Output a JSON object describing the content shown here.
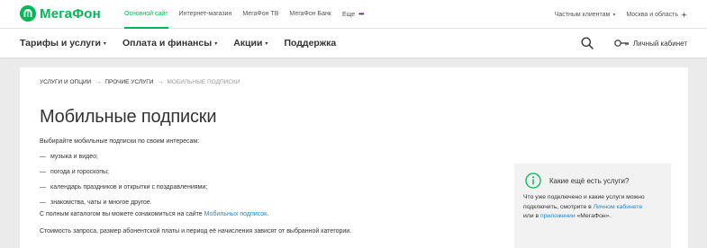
{
  "brand": {
    "name": "МегаФон",
    "color": "#00b956",
    "accent_purple": "#731982",
    "link_color": "#1e88c8"
  },
  "topbar": {
    "items": [
      {
        "label": "Основной сайт",
        "active": true
      },
      {
        "label": "Интернет-магазин",
        "active": false
      },
      {
        "label": "МегаФон ТВ",
        "active": false
      },
      {
        "label": "МегаФон Банк",
        "active": false
      }
    ],
    "more_label": "Еще",
    "more_dots": "•••",
    "clients_label": "Частным клиентам",
    "region_label": "Москва и область"
  },
  "mainnav": {
    "items": [
      {
        "label": "Тарифы и услуги",
        "dropdown": true
      },
      {
        "label": "Оплата и финансы",
        "dropdown": true
      },
      {
        "label": "Акции",
        "dropdown": true
      },
      {
        "label": "Поддержка",
        "dropdown": false
      }
    ],
    "search_icon": "search-icon",
    "account_icon": "key-icon",
    "account_label": "Личный кабинет"
  },
  "breadcrumbs": {
    "items": [
      "Услуги и опции",
      "Прочие услуги"
    ],
    "separator": "→",
    "current": "Мобильные подписки"
  },
  "page": {
    "title": "Мобильные подписки",
    "intro": "Выбирайте мобильные подписки по своим интересам:",
    "bullet_dash": "—",
    "bullets": [
      "музыка и видео;",
      "погода и гороскопы;",
      "календарь праздников и открытки с поздравлениями;",
      "знакомства, чаты и многое другое."
    ],
    "catalog_text": "С полным каталогом вы можете ознакомиться на сайте ",
    "catalog_link": "Мобильных подписок",
    "catalog_end": ".",
    "cost_text": "Стоимость запроса, размер абонентской платы и период её начисления зависят от выбранной категории."
  },
  "aside": {
    "icon": "info-icon",
    "title": "Какие ещё есть услуги?",
    "line1": "Что уже подключено и какие услуги можно",
    "line2_text": "подключить, смотрите в ",
    "line2_link": "Личном кабинете",
    "line3_text": "или в ",
    "line3_link": "приложении",
    "line3_end": " «МегаФон»."
  }
}
